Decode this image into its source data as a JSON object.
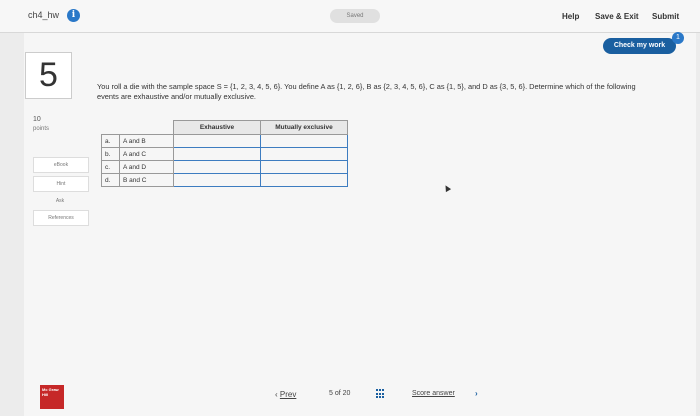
{
  "header": {
    "title": "ch4_hw",
    "saved": "Saved",
    "help": "Help",
    "save_exit": "Save & Exit",
    "submit": "Submit",
    "check_work": "Check my work",
    "check_badge": "1"
  },
  "question": {
    "number": "5",
    "points_value": "10",
    "points_label": "points",
    "text": "You roll a die with the sample space S = {1, 2, 3, 4, 5, 6}. You define A as {1, 2, 6}, B as {2, 3, 4, 5, 6}, C as {1, 5}, and D as {3, 5, 6}. Determine which of the following events are exhaustive and/or mutually exclusive."
  },
  "sidebar": {
    "ebook": "eBook",
    "hint": "Hint",
    "ask": "Ask",
    "references": "References"
  },
  "table": {
    "headers": [
      "Exhaustive",
      "Mutually exclusive"
    ],
    "rows": [
      {
        "letter": "a.",
        "events": "A and B"
      },
      {
        "letter": "b.",
        "events": "A and C"
      },
      {
        "letter": "c.",
        "events": "A and D"
      },
      {
        "letter": "d.",
        "events": "B and C"
      }
    ]
  },
  "footer": {
    "prev": "Prev",
    "page_current": "5",
    "page_of": "of",
    "page_total": "20",
    "score_answer": "Score answer",
    "logo_text": "Mc Graw Hill"
  },
  "colors": {
    "accent": "#1a5fa0",
    "info": "#2a78c8",
    "logo": "#c62828"
  }
}
